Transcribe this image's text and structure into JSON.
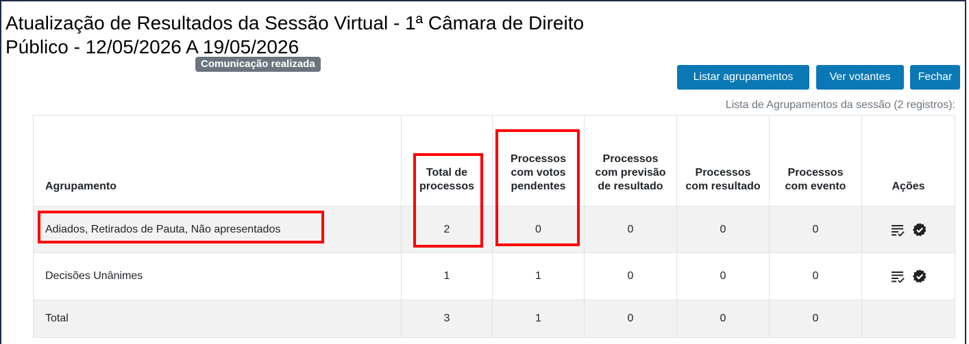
{
  "title": "Atualização de Resultados da Sessão Virtual - 1ª Câmara de Direito Público - 12/05/2026 A 19/05/2026",
  "badge": "Comunicação realizada",
  "buttons": {
    "list_groups": "Listar agrupamentos",
    "voters": "Ver votantes",
    "close": "Fechar"
  },
  "caption": "Lista de Agrupamentos da sessão (2 registros):",
  "table": {
    "headers": [
      "Agrupamento",
      "Total de processos",
      "Processos com votos pendentes",
      "Processos com previsão de resultado",
      "Processos com resultado",
      "Processos com evento",
      "Ações"
    ],
    "rows": [
      {
        "grouping": "Adiados, Retirados de Pauta, Não apresentados",
        "total": "2",
        "pending": "0",
        "forecast": "0",
        "result": "0",
        "event": "0"
      },
      {
        "grouping": "Decisões Unânimes",
        "total": "1",
        "pending": "1",
        "forecast": "0",
        "result": "0",
        "event": "0"
      }
    ],
    "total_row": {
      "label": "Total",
      "total": "3",
      "pending": "1",
      "forecast": "0",
      "result": "0",
      "event": "0"
    }
  },
  "icons": {
    "list_action": "list-check-icon",
    "confirm_action": "verified-badge-icon"
  },
  "colors": {
    "primary_button": "#0a78b5",
    "badge": "#6c757d",
    "highlight": "#ff0000"
  }
}
